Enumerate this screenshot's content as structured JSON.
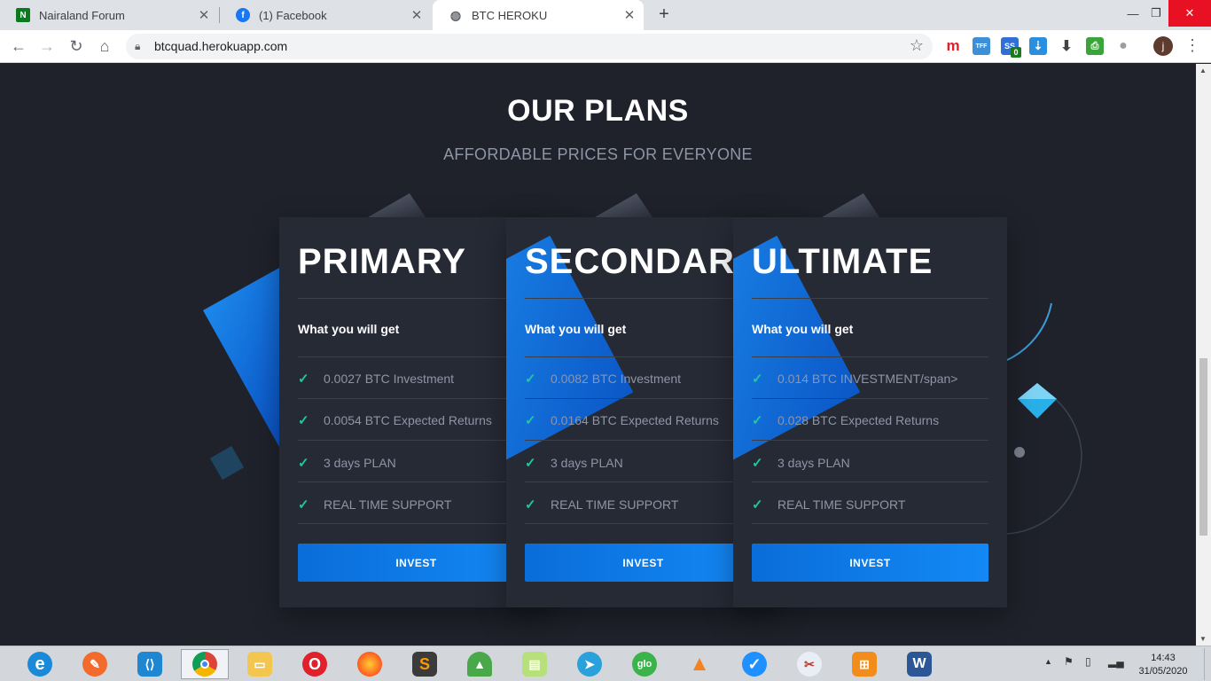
{
  "browser": {
    "tabs": [
      {
        "title": "Nairaland Forum",
        "icon": "nairaland-icon",
        "active": false
      },
      {
        "title": "(1) Facebook",
        "icon": "facebook-icon",
        "active": false
      },
      {
        "title": "BTC HEROKU",
        "icon": "globe-icon",
        "active": true
      }
    ],
    "url": "btcquad.herokuapp.com",
    "profile_initial": "j",
    "extension_badge": "0"
  },
  "plans_section": {
    "title": "OUR PLANS",
    "subtitle": "AFFORDABLE PRICES FOR EVERYONE"
  },
  "plans": [
    {
      "name": "PRIMARY",
      "heading": "What you will get",
      "features": [
        "0.0027 BTC Investment",
        "0.0054 BTC Expected Returns",
        "3 days PLAN",
        "REAL TIME SUPPORT"
      ],
      "button": "INVEST"
    },
    {
      "name": "SECONDARY",
      "heading": "What you will get",
      "features": [
        "0.0082 BTC Investment",
        "0.0164 BTC Expected Returns",
        "3 days PLAN",
        "REAL TIME SUPPORT"
      ],
      "button": "INVEST"
    },
    {
      "name": "ULTIMATE",
      "heading": "What you will get",
      "features": [
        "0.014 BTC INVESTMENT/span>",
        "0.028 BTC Expected Returns",
        "3 days PLAN",
        "REAL TIME SUPPORT"
      ],
      "button": "INVEST"
    }
  ],
  "taskbar": {
    "apps": [
      "internet-explorer-icon",
      "draw-icon",
      "vscode-icon",
      "chrome-icon",
      "file-explorer-icon",
      "opera-icon",
      "firefox-icon",
      "sublime-icon",
      "rocket-icon",
      "sticky-notes-icon",
      "telegram-icon",
      "glo-icon",
      "vlc-icon",
      "tasks-icon",
      "snipping-icon",
      "network-icon",
      "word-icon"
    ],
    "glo_label": "glo",
    "time": "14:43",
    "date": "31/05/2020"
  }
}
